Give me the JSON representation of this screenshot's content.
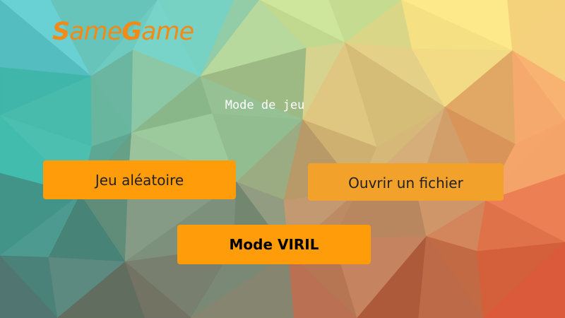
{
  "app": {
    "logo_first": "ame",
    "logo_first_cap": "S",
    "logo_second_cap": "G",
    "logo_second": "ame"
  },
  "menu": {
    "subtitle": "Mode de jeu",
    "random_label": "Jeu aléatoire",
    "open_file_label": "Ouvrir un fichier",
    "viril_label": "Mode VIRIL"
  },
  "colors": {
    "accent": "#ff9c0a",
    "logo": "#f18a17"
  }
}
